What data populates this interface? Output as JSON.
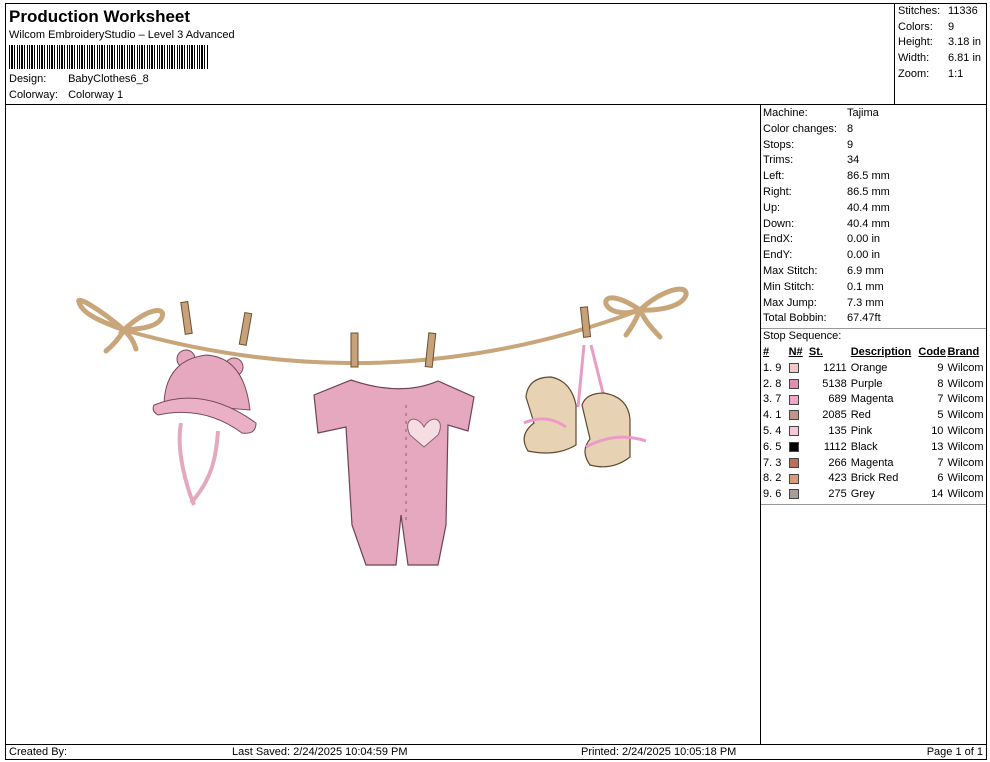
{
  "header": {
    "title": "Production Worksheet",
    "subtitle": "Wilcom EmbroideryStudio – Level 3 Advanced",
    "design_label": "Design:",
    "design_value": "BabyClothes6_8",
    "colorway_label": "Colorway:",
    "colorway_value": "Colorway 1"
  },
  "top_stats": [
    {
      "label": "Stitches:",
      "value": "11336"
    },
    {
      "label": "Colors:",
      "value": "9"
    },
    {
      "label": "Height:",
      "value": "3.18 in"
    },
    {
      "label": "Width:",
      "value": "6.81 in"
    },
    {
      "label": "Zoom:",
      "value": "1:1"
    }
  ],
  "machine_info": [
    {
      "label": "Machine:",
      "value": "Tajima"
    },
    {
      "label": "Color changes:",
      "value": "8"
    },
    {
      "label": "Stops:",
      "value": "9"
    },
    {
      "label": "Trims:",
      "value": "34"
    },
    {
      "label": "Left:",
      "value": "86.5 mm"
    },
    {
      "label": "Right:",
      "value": "86.5 mm"
    },
    {
      "label": "Up:",
      "value": "40.4 mm"
    },
    {
      "label": "Down:",
      "value": "40.4 mm"
    },
    {
      "label": "EndX:",
      "value": "0.00 in"
    },
    {
      "label": "EndY:",
      "value": "0.00 in"
    },
    {
      "label": "Max Stitch:",
      "value": "6.9 mm"
    },
    {
      "label": "Min Stitch:",
      "value": "0.1 mm"
    },
    {
      "label": "Max Jump:",
      "value": "7.3 mm"
    },
    {
      "label": "Total Bobbin:",
      "value": "67.47ft"
    }
  ],
  "stop_sequence": {
    "title": "Stop Sequence:",
    "headers": [
      "#",
      "N#",
      "St.",
      "Description",
      "Code",
      "Brand"
    ],
    "rows": [
      {
        "idx": "1.",
        "n": "9",
        "color": "#f3c9c3",
        "st": "1211",
        "desc": "Orange",
        "code": "9",
        "brand": "Wilcom"
      },
      {
        "idx": "2.",
        "n": "8",
        "color": "#e08fb0",
        "st": "5138",
        "desc": "Purple",
        "code": "8",
        "brand": "Wilcom"
      },
      {
        "idx": "3.",
        "n": "7",
        "color": "#f0a7c7",
        "st": "689",
        "desc": "Magenta",
        "code": "7",
        "brand": "Wilcom"
      },
      {
        "idx": "4.",
        "n": "1",
        "color": "#c4968a",
        "st": "2085",
        "desc": "Red",
        "code": "5",
        "brand": "Wilcom"
      },
      {
        "idx": "5.",
        "n": "4",
        "color": "#f6c7d6",
        "st": "135",
        "desc": "Pink",
        "code": "10",
        "brand": "Wilcom"
      },
      {
        "idx": "6.",
        "n": "5",
        "color": "#000000",
        "st": "1112",
        "desc": "Black",
        "code": "13",
        "brand": "Wilcom"
      },
      {
        "idx": "7.",
        "n": "3",
        "color": "#b96f59",
        "st": "266",
        "desc": "Magenta",
        "code": "7",
        "brand": "Wilcom"
      },
      {
        "idx": "8.",
        "n": "2",
        "color": "#d59c7c",
        "st": "423",
        "desc": "Brick Red",
        "code": "6",
        "brand": "Wilcom"
      },
      {
        "idx": "9.",
        "n": "6",
        "color": "#a89f99",
        "st": "275",
        "desc": "Grey",
        "code": "14",
        "brand": "Wilcom"
      }
    ]
  },
  "footer": {
    "created_by": "Created By:",
    "last_saved": "Last Saved: 2/24/2025 10:04:59 PM",
    "printed": "Printed: 2/24/2025 10:05:18 PM",
    "page": "Page 1 of 1"
  },
  "colors": {
    "rope": "#c9a57a",
    "clothes_pink": "#e6a8bf",
    "bootie_tan": "#e7d3b3",
    "ribbon_pink": "#eb9cc6"
  }
}
